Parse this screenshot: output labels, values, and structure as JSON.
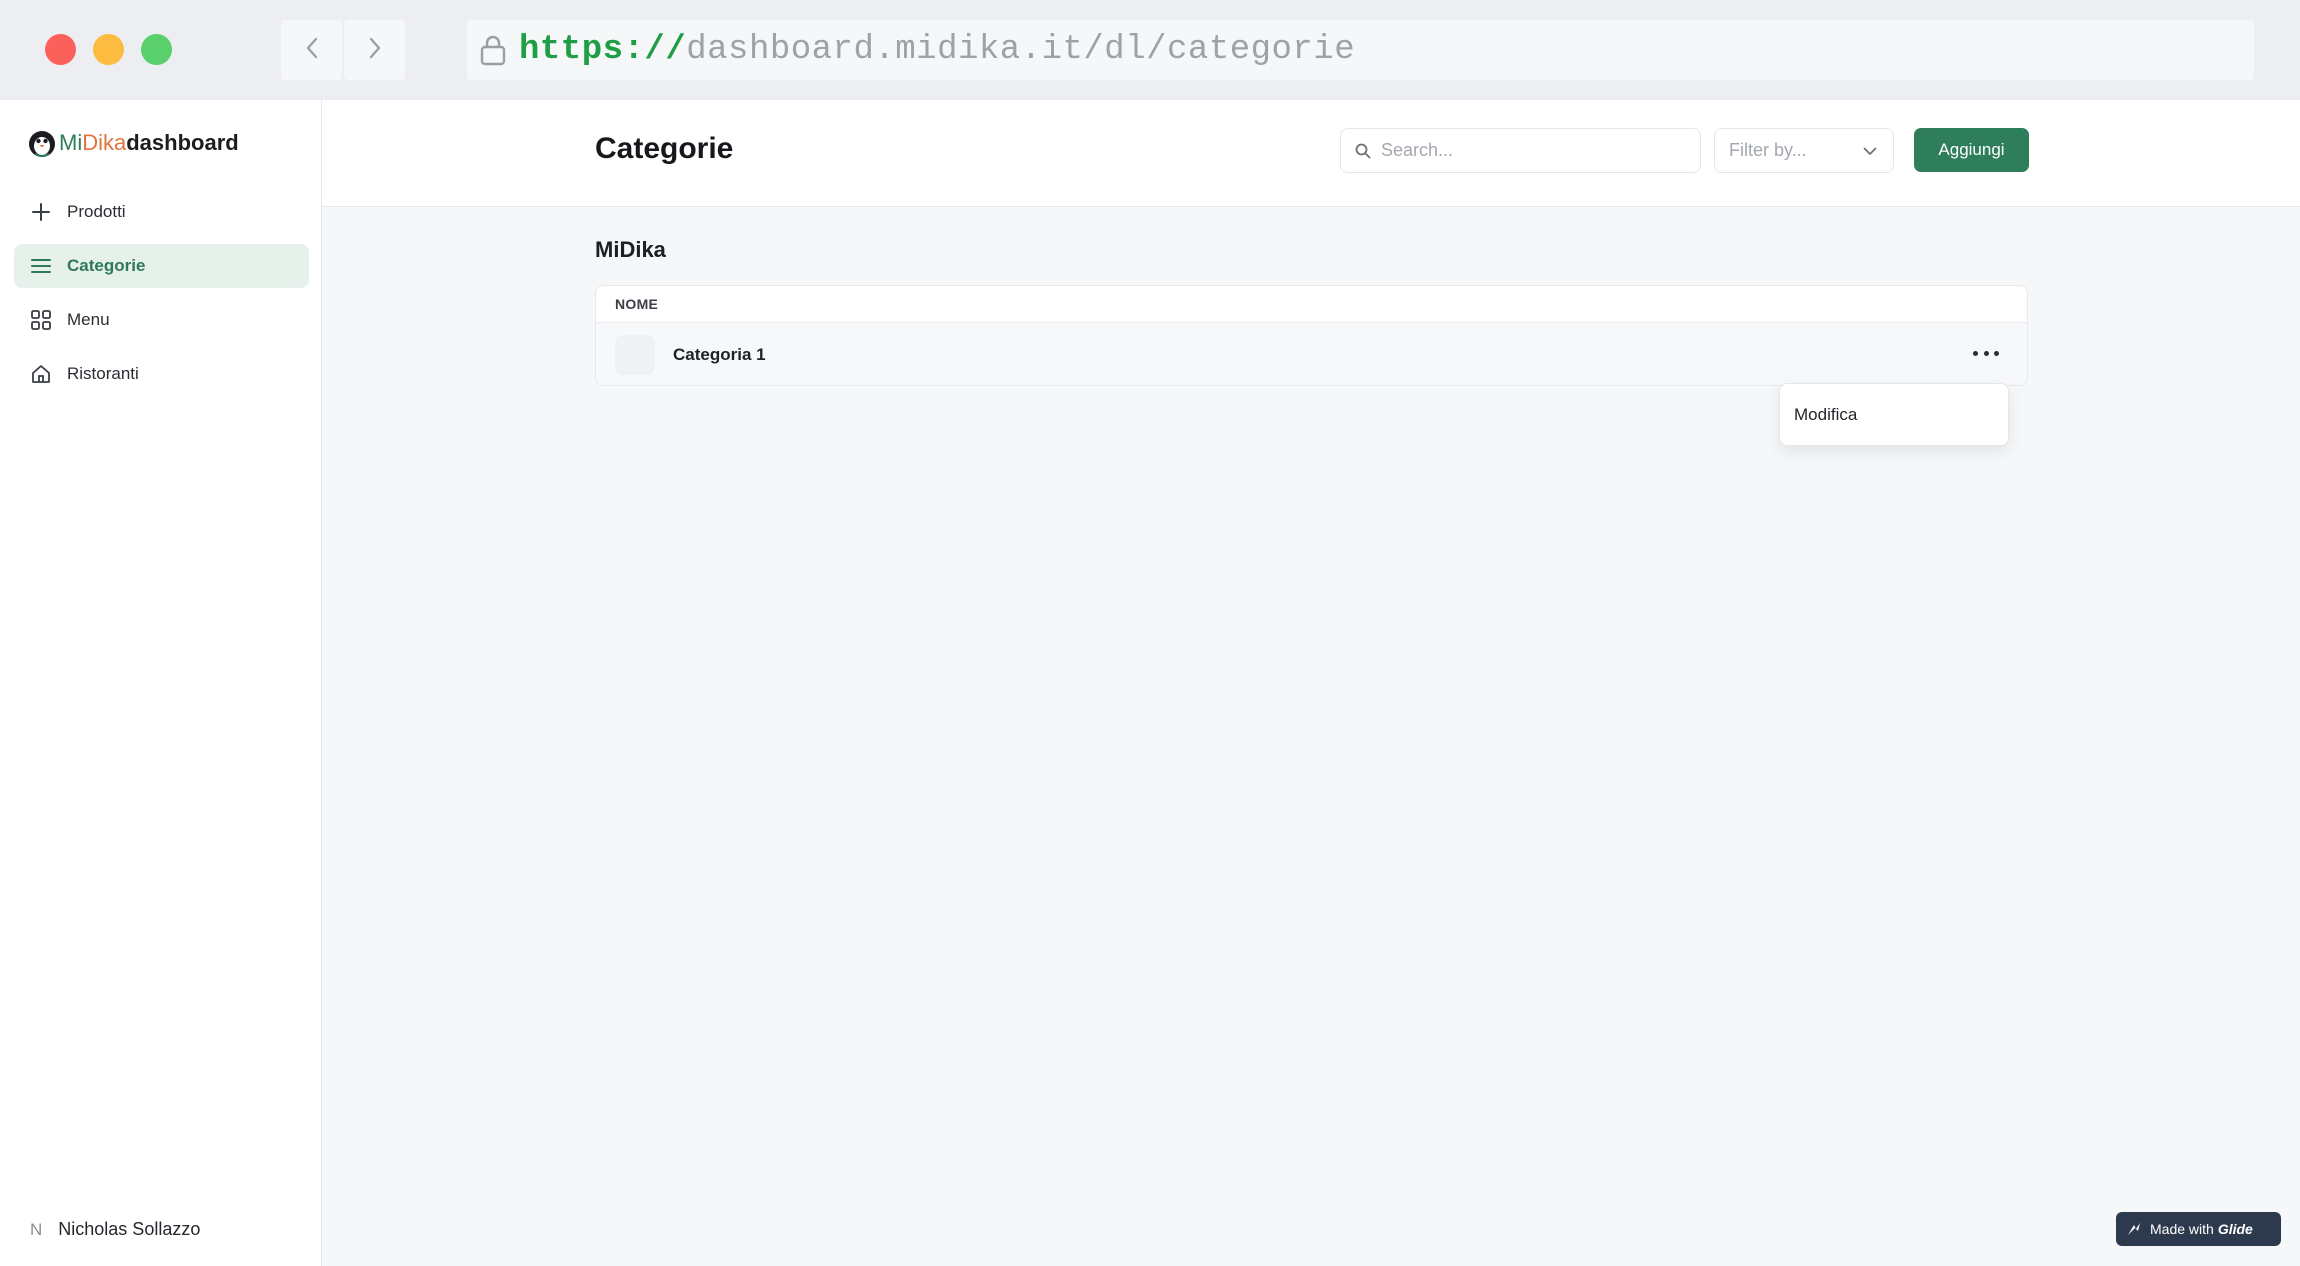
{
  "browser": {
    "url_protocol": "https://",
    "url_rest": "dashboard.midika.it/dl/categorie",
    "icons": [
      "back-arrow-icon",
      "forward-arrow-icon",
      "lock-icon"
    ]
  },
  "brand": {
    "name_part1": "Mi",
    "name_part2": "Dika",
    "name_part3": "dashboard",
    "colors": {
      "mi": "#2e7d5b",
      "dika": "#e2733c"
    }
  },
  "sidebar": {
    "items": [
      {
        "label": "Prodotti",
        "icon": "plus-icon",
        "active": false
      },
      {
        "label": "Categorie",
        "icon": "list-icon",
        "active": true
      },
      {
        "label": "Menu",
        "icon": "grid-icon",
        "active": false
      },
      {
        "label": "Ristoranti",
        "icon": "home-icon",
        "active": false
      }
    ],
    "user": {
      "initial": "N",
      "name": "Nicholas Sollazzo"
    }
  },
  "header": {
    "title": "Categorie",
    "search_placeholder": "Search...",
    "filter_placeholder": "Filter by...",
    "add_label": "Aggiungi",
    "accent": "#2e7d5b"
  },
  "main": {
    "section_title": "MiDika",
    "table": {
      "columns": [
        "NOME"
      ],
      "rows": [
        {
          "name": "Categoria 1"
        }
      ]
    },
    "row_menu": {
      "items": [
        "Modifica"
      ]
    }
  },
  "footer": {
    "made_with": "Made with",
    "made_with_brand": "Glide"
  }
}
